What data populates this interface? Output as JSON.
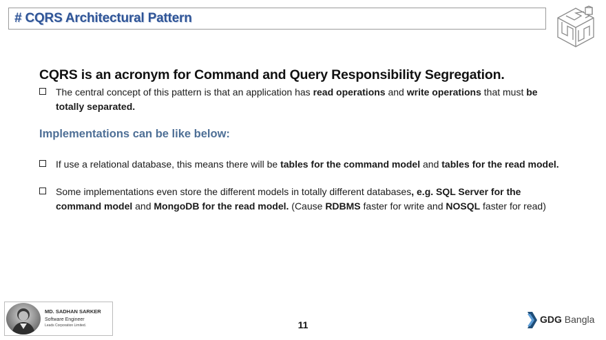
{
  "header": {
    "title": "# CQRS Architectural Pattern"
  },
  "main": {
    "headline": "CQRS is an acronym for Command and Query Responsibility Segregation.",
    "bullet1": {
      "part1": "The central concept of this pattern is that an application has ",
      "bold1": "read operations",
      "part2": " and ",
      "bold2": "write operations",
      "part3": " that must ",
      "bold3": "be totally separated."
    },
    "subheading": "Implementations can be like below:",
    "bullet2": {
      "part1": "If use a relational database, this means there will be ",
      "bold1": "tables for the command model",
      "part2": " and ",
      "bold2": "tables for the read model."
    },
    "bullet3": {
      "part1": "Some implementations even store the different models in totally different databases",
      "bold1": ", e.g. SQL Server for the command model",
      "part2": " and ",
      "bold2": "MongoDB for the read model.",
      "part3": " (Cause ",
      "bold3": "RDBMS",
      "part4": " faster for write and ",
      "bold4": "NOSQL",
      "part5": " faster for read)"
    }
  },
  "footer": {
    "author_name": "MD. SADHAN SARKER",
    "author_role": "Software Engineer",
    "author_org": "Leads Corporation Limited.",
    "page_number": "11",
    "brand_bold": "GDG",
    "brand_rest": " Bangla"
  },
  "colors": {
    "title": "#2f5597",
    "subheading": "#4e6f96"
  },
  "icons": [
    "cube-maze-logo-icon",
    "checkbox-bullet-icon",
    "gdg-chevron-icon"
  ]
}
